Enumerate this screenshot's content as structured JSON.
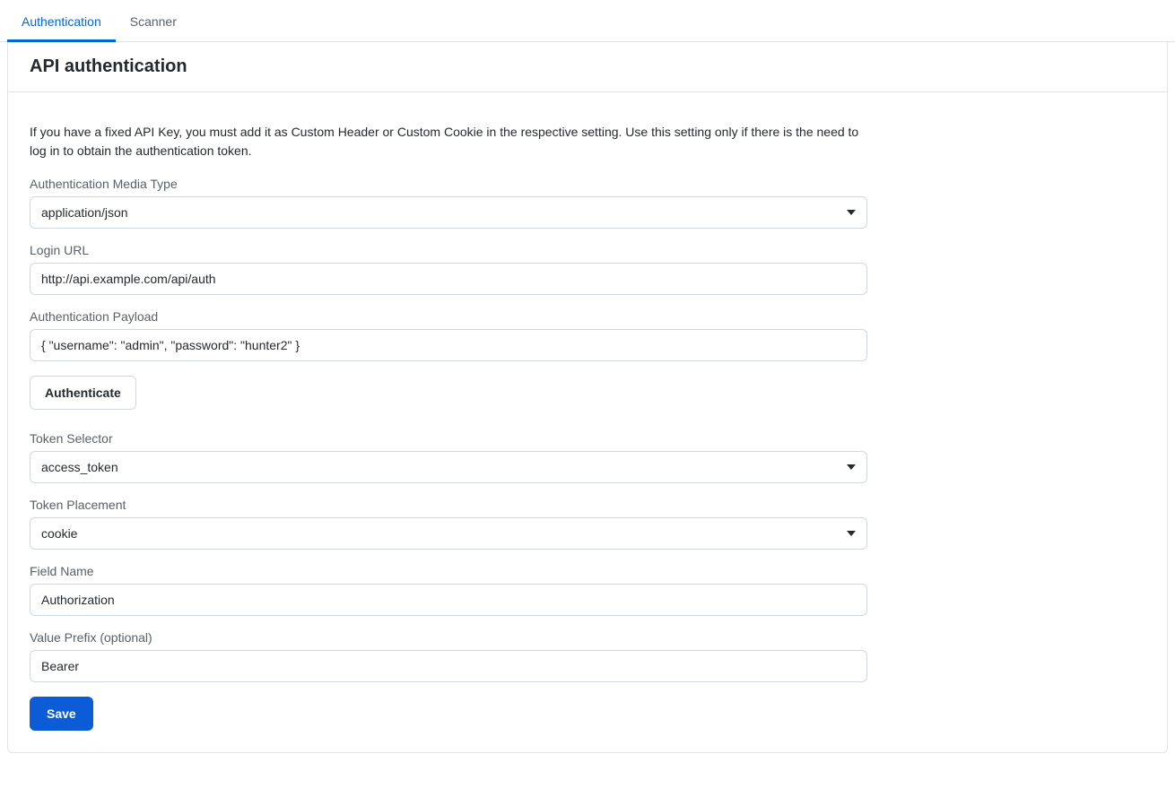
{
  "tabs": {
    "authentication": "Authentication",
    "scanner": "Scanner"
  },
  "header": {
    "title": "API authentication"
  },
  "intro": "If you have a fixed API Key, you must add it as Custom Header or Custom Cookie in the respective setting. Use this setting only if there is the need to log in to obtain the authentication token.",
  "form": {
    "auth_media_type": {
      "label": "Authentication Media Type",
      "value": "application/json"
    },
    "login_url": {
      "label": "Login URL",
      "value": "http://api.example.com/api/auth"
    },
    "auth_payload": {
      "label": "Authentication Payload",
      "value": "{ \"username\": \"admin\", \"password\": \"hunter2\" }"
    },
    "authenticate_label": "Authenticate",
    "token_selector": {
      "label": "Token Selector",
      "value": "access_token"
    },
    "token_placement": {
      "label": "Token Placement",
      "value": "cookie"
    },
    "field_name": {
      "label": "Field Name",
      "value": "Authorization"
    },
    "value_prefix": {
      "label": "Value Prefix (optional)",
      "value": "Bearer"
    },
    "save_label": "Save"
  }
}
